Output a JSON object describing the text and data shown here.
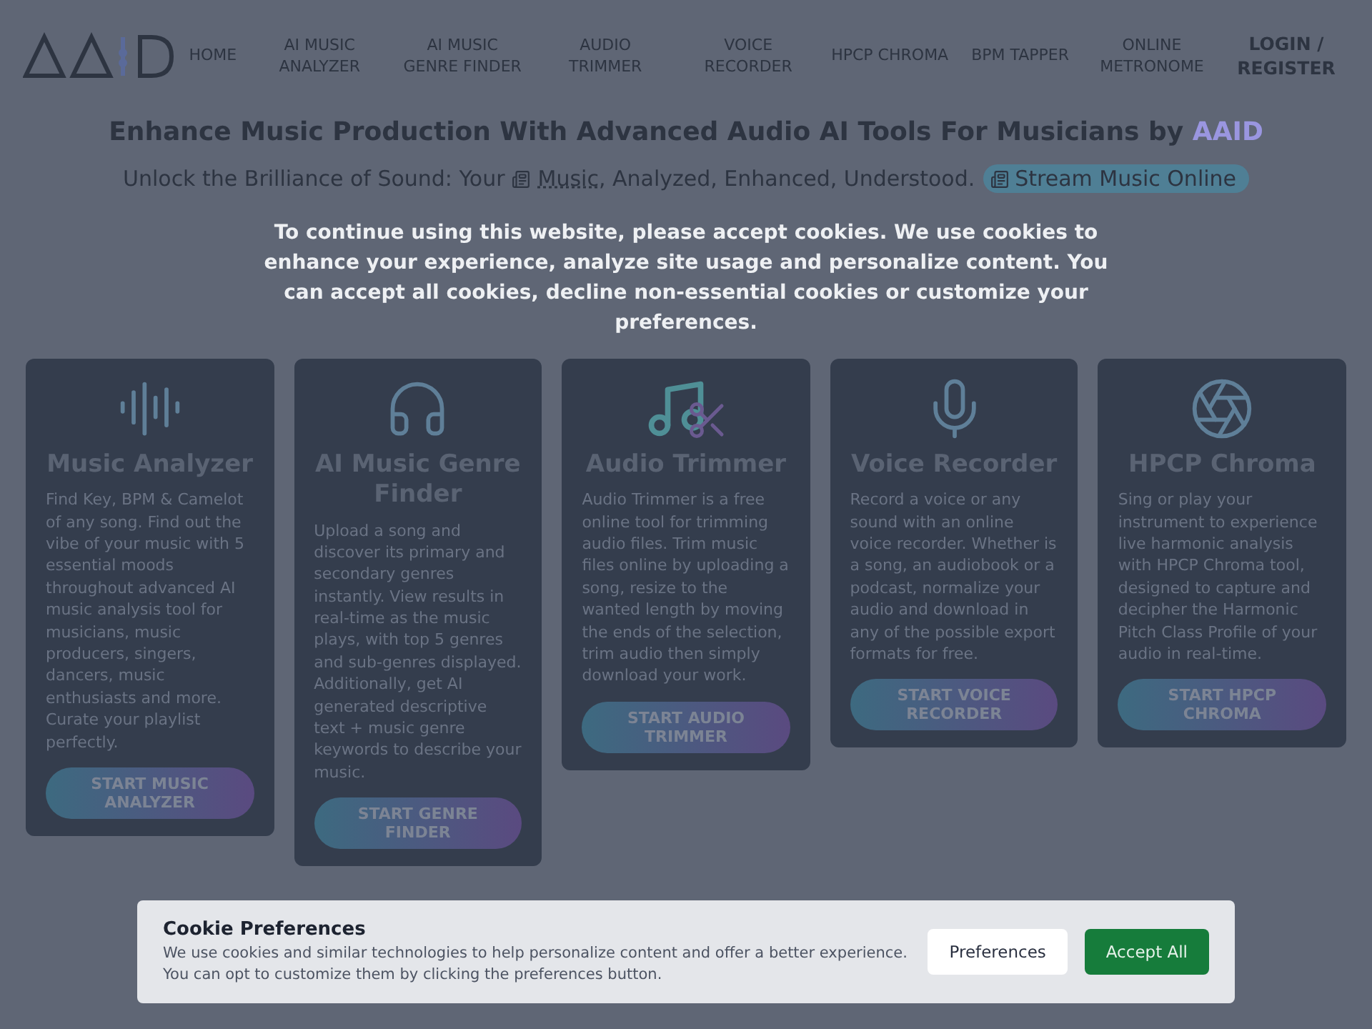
{
  "nav": {
    "items": [
      {
        "label": "HOME",
        "kind": "link"
      },
      {
        "label": "AI MUSIC ANALYZER",
        "kind": "link"
      },
      {
        "label": "AI MUSIC GENRE FINDER",
        "kind": "link"
      },
      {
        "label": "AUDIO TRIMMER",
        "kind": "link"
      },
      {
        "label": "VOICE RECORDER",
        "kind": "link"
      },
      {
        "label": "HPCP CHROMA",
        "kind": "link"
      },
      {
        "label": "BPM TAPPER",
        "kind": "link"
      },
      {
        "label": "ONLINE METRONOME",
        "kind": "link"
      },
      {
        "label": "LOGIN / REGISTER",
        "kind": "login"
      }
    ]
  },
  "hero": {
    "title": "Enhance Music Production With Advanced Audio AI Tools For Musicians by",
    "brand": "AAID",
    "subtitle_before": "Unlock the Brilliance of Sound: Your",
    "subtitle_link": "Music",
    "subtitle_after": ", Analyzed, Enhanced, Understood.",
    "stream_button": "Stream Music Online"
  },
  "consent_message": "To continue using this website, please accept cookies. We use cookies to enhance your experience, analyze site usage and personalize content. You can accept all cookies, decline non-essential cookies or customize your preferences.",
  "cards": [
    {
      "kind": "waveform",
      "title": "Music Analyzer",
      "description": "Find Key, BPM & Camelot of any song. Find out the vibe of your music with 5 essential moods throughout advanced AI music analysis tool for musicians, music producers, singers, dancers, music enthusiasts and more. Curate your playlist perfectly.",
      "button": "START MUSIC ANALYZER"
    },
    {
      "kind": "headphones",
      "title": "AI Music Genre Finder",
      "description": "Upload a song and discover its primary and secondary genres instantly. View results in real-time as the music plays, with top 5 genres and sub-genres displayed. Additionally, get AI generated descriptive text + music genre keywords to describe your music.",
      "button": "START GENRE FINDER"
    },
    {
      "kind": "note-scissors",
      "title": "Audio Trimmer",
      "description": "Audio Trimmer is a free online tool for trimming audio files. Trim music files online by uploading a song, resize to the wanted length by moving the ends of the selection, trim audio then simply download your work.",
      "button": "START AUDIO TRIMMER"
    },
    {
      "kind": "microphone",
      "title": "Voice Recorder",
      "description": "Record a voice or any sound with an online voice recorder. Whether is a song, an audiobook or a podcast, normalize your audio and download in any of the possible export formats for free.",
      "button": "START VOICE RECORDER"
    },
    {
      "kind": "aperture",
      "title": "HPCP Chroma",
      "description": "Sing or play your instrument to experience live harmonic analysis with HPCP Chroma tool, designed to capture and decipher the Harmonic Pitch Class Profile of your audio in real-time.",
      "button": "START HPCP CHROMA"
    }
  ],
  "cookie_banner": {
    "title": "Cookie Preferences",
    "text_1": "We use cookies and similar technologies to help personalize content and offer a better experience.",
    "text_2": "You can opt to customize them by clicking the preferences button.",
    "buttons": [
      {
        "label": "Preferences",
        "kind": "secondary"
      },
      {
        "label": "Accept All",
        "kind": "primary"
      }
    ]
  }
}
